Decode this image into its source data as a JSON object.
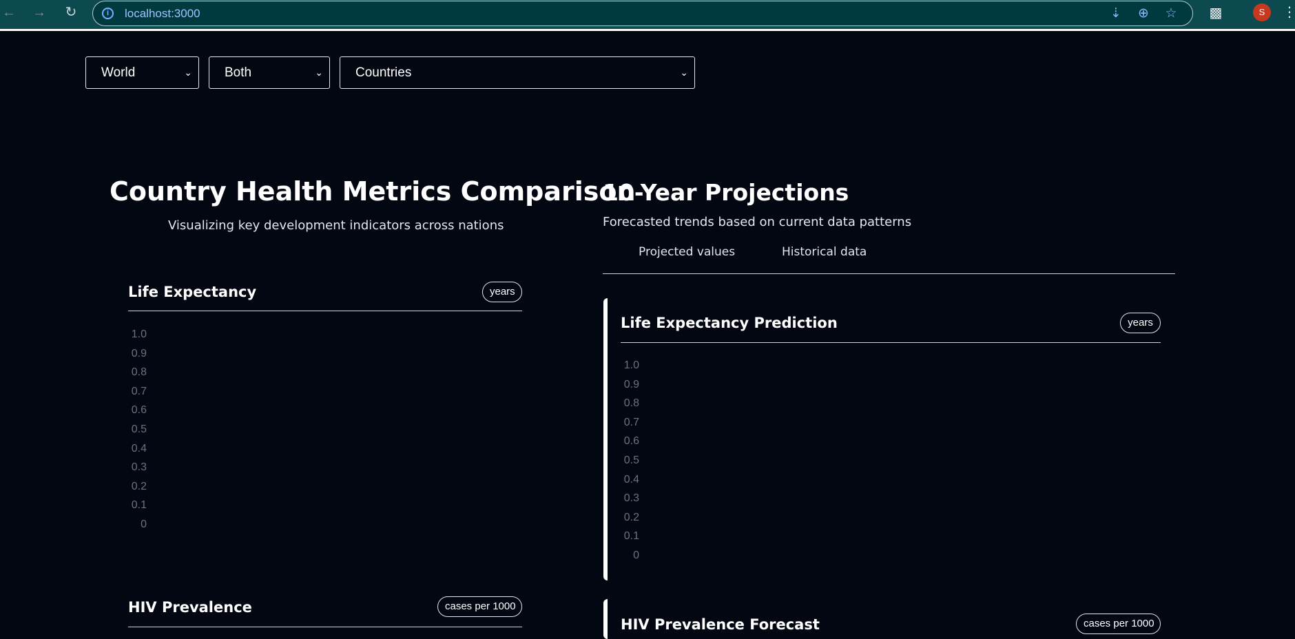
{
  "browser": {
    "url": "localhost:3000",
    "back_icon": "arrow-left-icon",
    "forward_icon": "arrow-right-icon",
    "reload_icon": "reload-icon",
    "avatar_letter": "S"
  },
  "filters": {
    "region": "World",
    "sex": "Both",
    "countries": "Countries"
  },
  "left": {
    "title": "Country Health Metrics Comparison",
    "subtitle": "Visualizing key development indicators across nations",
    "cards": [
      {
        "title": "Life Expectancy",
        "unit": "years",
        "yticks": [
          "1.0",
          "0.9",
          "0.8",
          "0.7",
          "0.6",
          "0.5",
          "0.4",
          "0.3",
          "0.2",
          "0.1",
          "0"
        ]
      },
      {
        "title": "HIV Prevalence",
        "unit": "cases per 1000"
      }
    ]
  },
  "right": {
    "title": "10-Year Projections",
    "subtitle": "Forecasted trends based on current data patterns",
    "tabs": [
      "Projected values",
      "Historical data"
    ],
    "cards": [
      {
        "title": "Life Expectancy Prediction",
        "unit": "years",
        "yticks": [
          "1.0",
          "0.9",
          "0.8",
          "0.7",
          "0.6",
          "0.5",
          "0.4",
          "0.3",
          "0.2",
          "0.1",
          "0"
        ]
      },
      {
        "title": "HIV Prevalence Forecast",
        "unit": "cases per 1000"
      }
    ]
  },
  "colors": {
    "background": "#030712",
    "chrome": "#0d4a50",
    "tick": "#6b7280"
  }
}
